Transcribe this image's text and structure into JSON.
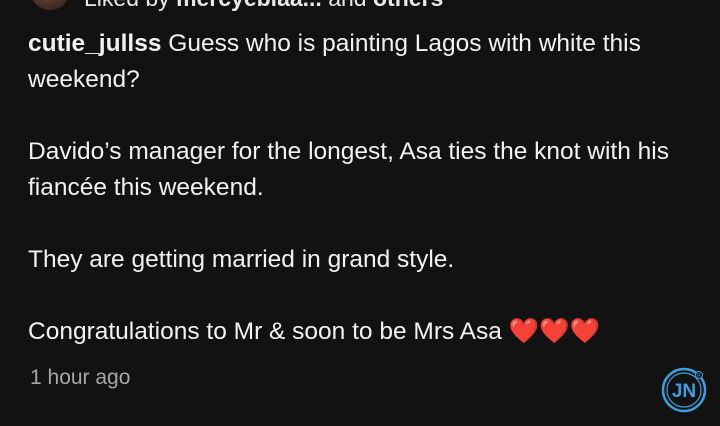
{
  "likes": {
    "prefix": "Liked by ",
    "user": "mercyebiaa...",
    "suffix": " and ",
    "others": "others"
  },
  "post": {
    "username": "cutie_jullss",
    "paragraphs": [
      "Guess who is painting Lagos with white this weekend?",
      "Davido’s manager for the longest, Asa ties the knot with his fiancée this weekend.",
      "They are getting married in grand style.",
      "Congratulations to Mr & soon to be Mrs Asa ❤️❤️❤️"
    ],
    "timestamp": "1 hour ago"
  },
  "watermark": {
    "text": "JN",
    "icon": "jn-logo-icon",
    "color": "#3aa0e0"
  }
}
